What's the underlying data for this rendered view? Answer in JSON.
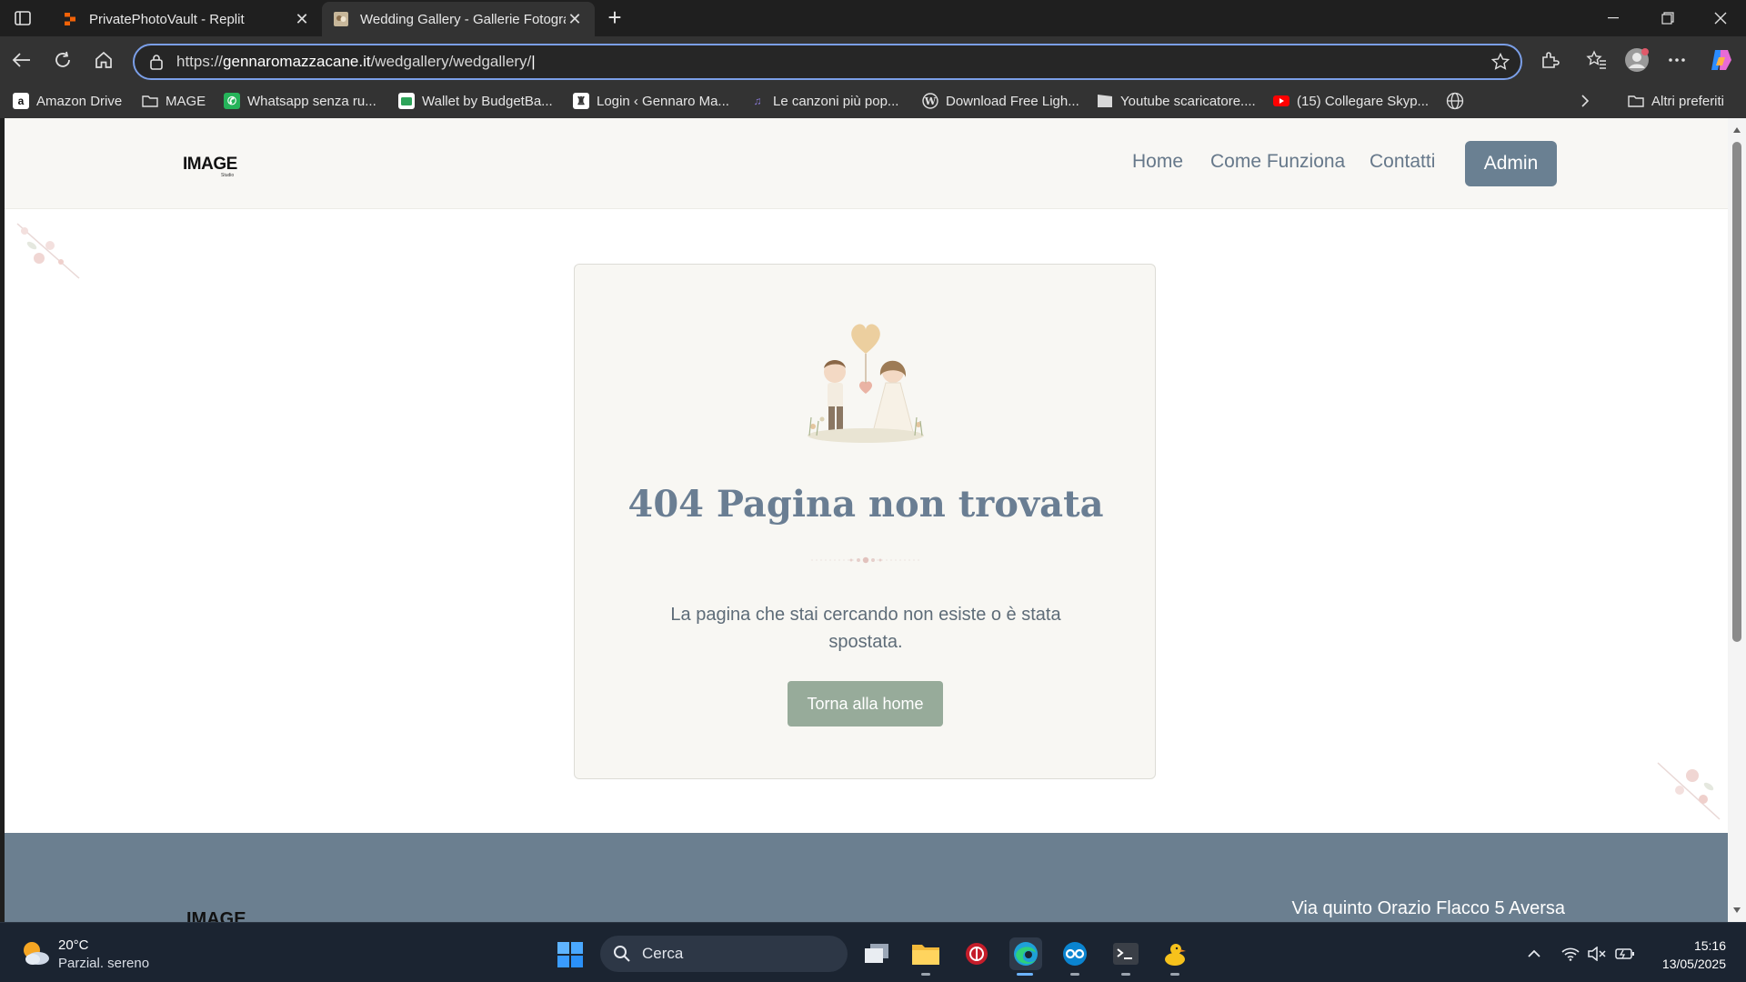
{
  "browser": {
    "tabs": [
      {
        "title": "PrivatePhotoVault - Replit",
        "active": false
      },
      {
        "title": "Wedding Gallery - Gallerie Fotografiche",
        "active": true
      }
    ],
    "url_prefix": "https://",
    "url_domain": "gennaromazzacane.it",
    "url_path": "/wedgallery/wedgallery/",
    "bookmarks": [
      {
        "label": "Amazon Drive",
        "icon": "amazon-icon"
      },
      {
        "label": "MAGE",
        "icon": "folder-icon"
      },
      {
        "label": "Whatsapp senza ru...",
        "icon": "whatsapp-icon"
      },
      {
        "label": "Wallet by BudgetBa...",
        "icon": "wallet-icon"
      },
      {
        "label": "Login ‹ Gennaro Ma...",
        "icon": "login-icon"
      },
      {
        "label": "Le canzoni più pop...",
        "icon": "music-icon"
      },
      {
        "label": "Download Free Ligh...",
        "icon": "wordpress-icon"
      },
      {
        "label": "Youtube scaricatore....",
        "icon": "clapper-icon"
      },
      {
        "label": "(15) Collegare Skyp...",
        "icon": "youtube-icon"
      }
    ],
    "other_favorites": "Altri preferiti"
  },
  "site": {
    "logo": "IMAGE",
    "logo_sub": "Studio",
    "nav": [
      "Home",
      "Come Funziona",
      "Contatti"
    ],
    "admin_label": "Admin",
    "error_title": "404 Pagina non trovata",
    "error_message": "La pagina che stai cercando non esiste o è stata spostata.",
    "home_button": "Torna alla home",
    "footer_logo": "IMAGE",
    "footer_address": "Via quinto Orazio Flacco 5 Aversa"
  },
  "taskbar": {
    "temperature": "20°C",
    "weather": "Parzial. sereno",
    "search_placeholder": "Cerca",
    "time": "15:16",
    "date": "13/05/2025"
  },
  "colors": {
    "accent_slate": "#6a8092",
    "sage_button": "#97ab9a",
    "footer": "#6b7f90",
    "header_bg": "#f8f7f4"
  }
}
